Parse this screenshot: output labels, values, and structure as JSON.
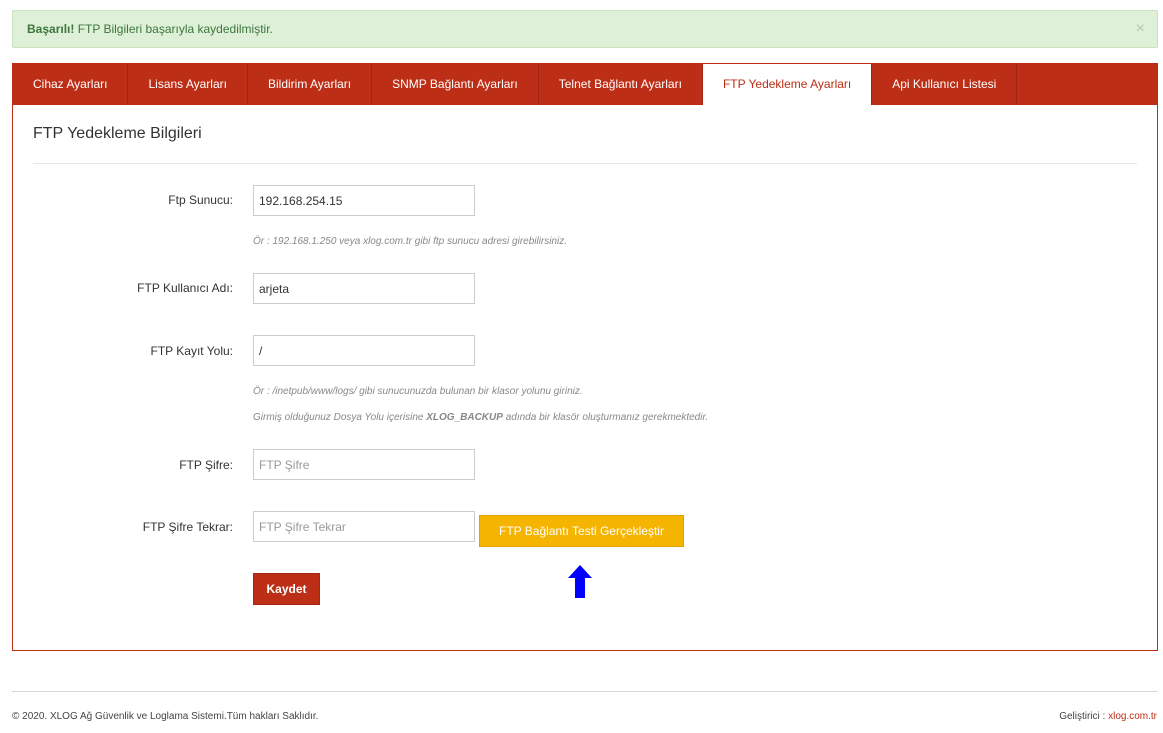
{
  "alert": {
    "strong": "Başarılı!",
    "message": " FTP Bilgileri başarıyla kaydedilmiştir.",
    "close": "×"
  },
  "tabs": [
    {
      "label": "Cihaz Ayarları"
    },
    {
      "label": "Lisans Ayarları"
    },
    {
      "label": "Bildirim Ayarları"
    },
    {
      "label": "SNMP Bağlantı Ayarları"
    },
    {
      "label": "Telnet Bağlantı Ayarları"
    },
    {
      "label": "FTP Yedekleme Ayarları"
    },
    {
      "label": "Api Kullanıcı Listesi"
    }
  ],
  "form": {
    "title": "FTP Yedekleme Bilgileri",
    "server_label": "Ftp Sunucu:",
    "server_value": "192.168.254.15",
    "server_help": "Ör : 192.168.1.250 veya xlog.com.tr gibi ftp sunucu adresi girebilirsiniz.",
    "user_label": "FTP Kullanıcı Adı:",
    "user_value": "arjeta",
    "path_label": "FTP Kayıt Yolu:",
    "path_value": "/",
    "path_help1": "Ör : /inetpub/www/logs/ gibi sunucunuzda bulunan bir klasor yolunu giriniz.",
    "path_help2_pre": "Girmiş olduğunuz Dosya Yolu içerisine ",
    "path_help2_bold": "XLOG_BACKUP",
    "path_help2_post": " adında bir klasör oluşturmanız gerekmektedir.",
    "password_label": "FTP Şifre:",
    "password_placeholder": "FTP Şifre",
    "password_repeat_label": "FTP Şifre Tekrar:",
    "password_repeat_placeholder": "FTP Şifre Tekrar",
    "test_button": "FTP Bağlantı Testi Gerçekleştir",
    "save_button": "Kaydet"
  },
  "footer": {
    "copyright": "© 2020. XLOG Ağ Güvenlik ve Loglama Sistemi.Tüm hakları Saklıdır.",
    "developer_label": "Geliştirici : ",
    "developer_link": "xlog.com.tr"
  },
  "colors": {
    "brand": "#bd2e16",
    "success_bg": "#dff0d8",
    "success_text": "#3c763d",
    "test_button": "#f5b400",
    "annotation_arrow": "#0000ff"
  },
  "annotation": {
    "icon": "arrow-up-icon"
  }
}
